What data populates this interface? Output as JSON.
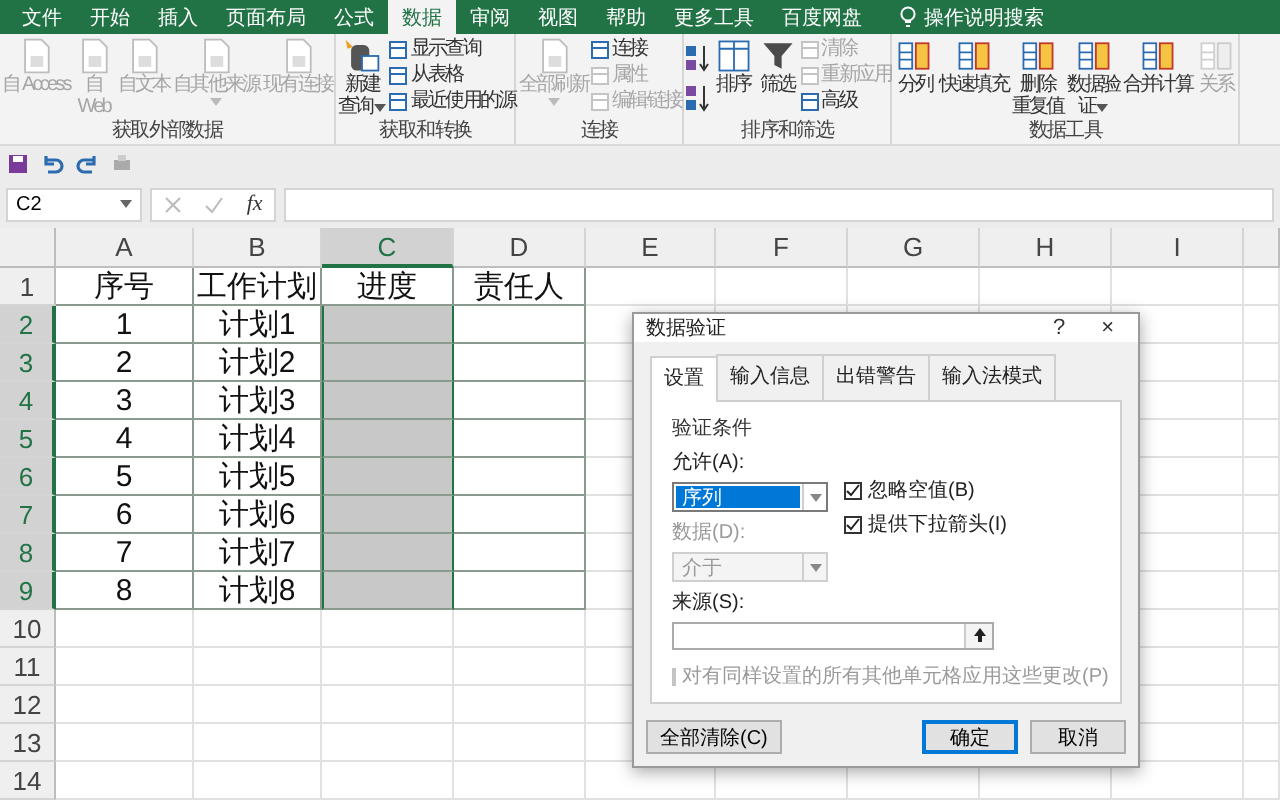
{
  "ribbon_tabs": [
    {
      "label": "文件",
      "selected": false
    },
    {
      "label": "开始",
      "selected": false
    },
    {
      "label": "插入",
      "selected": false
    },
    {
      "label": "页面布局",
      "selected": false
    },
    {
      "label": "公式",
      "selected": false
    },
    {
      "label": "数据",
      "selected": true
    },
    {
      "label": "审阅",
      "selected": false
    },
    {
      "label": "视图",
      "selected": false
    },
    {
      "label": "帮助",
      "selected": false
    },
    {
      "label": "更多工具",
      "selected": false
    },
    {
      "label": "百度网盘",
      "selected": false
    }
  ],
  "search": {
    "label": "操作说明搜索"
  },
  "ribbon_groups": [
    {
      "label": "获取外部数据",
      "items": [
        {
          "kind": "large",
          "lines": [
            "自 Access"
          ],
          "disabled": true,
          "dropdown": false
        },
        {
          "kind": "large",
          "lines": [
            "自",
            "Web"
          ],
          "disabled": true,
          "dropdown": false
        },
        {
          "kind": "large",
          "lines": [
            "自文本"
          ],
          "disabled": true,
          "dropdown": false
        },
        {
          "kind": "large",
          "lines": [
            "自其他来源"
          ],
          "disabled": true,
          "dropdown": true
        },
        {
          "kind": "large",
          "lines": [
            "现有连接"
          ],
          "disabled": true,
          "dropdown": false
        }
      ]
    },
    {
      "label": "获取和转换",
      "items": [
        {
          "kind": "large",
          "lines": [
            "新建",
            "查询"
          ],
          "disabled": false,
          "dropdown": true
        },
        {
          "kind": "stack",
          "items": [
            {
              "label": "显示查询",
              "disabled": false
            },
            {
              "label": "从表格",
              "disabled": false
            },
            {
              "label": "最近使用的源",
              "disabled": false
            }
          ]
        }
      ]
    },
    {
      "label": "连接",
      "items": [
        {
          "kind": "large",
          "lines": [
            "全部刷新"
          ],
          "disabled": true,
          "dropdown": true
        },
        {
          "kind": "stack",
          "items": [
            {
              "label": "连接",
              "disabled": false
            },
            {
              "label": "属性",
              "disabled": true
            },
            {
              "label": "编辑链接",
              "disabled": true
            }
          ]
        }
      ]
    },
    {
      "label": "排序和筛选",
      "items": [
        {
          "kind": "sort"
        },
        {
          "kind": "large",
          "lines": [
            "排序"
          ],
          "disabled": false,
          "dropdown": false
        },
        {
          "kind": "large",
          "lines": [
            "筛选"
          ],
          "disabled": false,
          "dropdown": false
        },
        {
          "kind": "stack",
          "items": [
            {
              "label": "清除",
              "disabled": true
            },
            {
              "label": "重新应用",
              "disabled": true
            },
            {
              "label": "高级",
              "disabled": false
            }
          ]
        }
      ]
    },
    {
      "label": "数据工具",
      "items": [
        {
          "kind": "large",
          "lines": [
            "分列"
          ],
          "disabled": false,
          "dropdown": false
        },
        {
          "kind": "large",
          "lines": [
            "快速填充"
          ],
          "disabled": false,
          "dropdown": false
        },
        {
          "kind": "large",
          "lines": [
            "删除",
            "重复值"
          ],
          "disabled": false,
          "dropdown": false
        },
        {
          "kind": "large",
          "lines": [
            "数据验",
            "证"
          ],
          "disabled": false,
          "dropdown": true
        },
        {
          "kind": "large",
          "lines": [
            "合并计算"
          ],
          "disabled": false,
          "dropdown": false
        },
        {
          "kind": "large",
          "lines": [
            "关系"
          ],
          "disabled": true,
          "dropdown": false
        }
      ]
    }
  ],
  "name_box": {
    "value": "C2"
  },
  "formula_bar": {
    "function_label": "fx"
  },
  "sheet": {
    "columns": [
      {
        "label": "A",
        "selected": false
      },
      {
        "label": "B",
        "selected": false
      },
      {
        "label": "C",
        "selected": true
      },
      {
        "label": "D",
        "selected": false
      },
      {
        "label": "E",
        "selected": false
      },
      {
        "label": "F",
        "selected": false
      },
      {
        "label": "G",
        "selected": false
      },
      {
        "label": "H",
        "selected": false
      },
      {
        "label": "I",
        "selected": false
      }
    ],
    "rows": [
      {
        "number": "1",
        "selected": false,
        "cells": [
          {
            "text": "序号",
            "selected": false
          },
          {
            "text": "工作计划",
            "selected": false
          },
          {
            "text": "进度",
            "selected": false
          },
          {
            "text": "责任人",
            "selected": false
          }
        ]
      },
      {
        "number": "2",
        "selected": true,
        "cells": [
          {
            "text": "1",
            "selected": false
          },
          {
            "text": "计划1",
            "selected": false
          },
          {
            "text": "",
            "selected": true
          },
          {
            "text": "",
            "selected": false
          }
        ]
      },
      {
        "number": "3",
        "selected": true,
        "cells": [
          {
            "text": "2",
            "selected": false
          },
          {
            "text": "计划2",
            "selected": false
          },
          {
            "text": "",
            "selected": true
          },
          {
            "text": "",
            "selected": false
          }
        ]
      },
      {
        "number": "4",
        "selected": true,
        "cells": [
          {
            "text": "3",
            "selected": false
          },
          {
            "text": "计划3",
            "selected": false
          },
          {
            "text": "",
            "selected": true
          },
          {
            "text": "",
            "selected": false
          }
        ]
      },
      {
        "number": "5",
        "selected": true,
        "cells": [
          {
            "text": "4",
            "selected": false
          },
          {
            "text": "计划4",
            "selected": false
          },
          {
            "text": "",
            "selected": true
          },
          {
            "text": "",
            "selected": false
          }
        ]
      },
      {
        "number": "6",
        "selected": true,
        "cells": [
          {
            "text": "5",
            "selected": false
          },
          {
            "text": "计划5",
            "selected": false
          },
          {
            "text": "",
            "selected": true
          },
          {
            "text": "",
            "selected": false
          }
        ]
      },
      {
        "number": "7",
        "selected": true,
        "cells": [
          {
            "text": "6",
            "selected": false
          },
          {
            "text": "计划6",
            "selected": false
          },
          {
            "text": "",
            "selected": true
          },
          {
            "text": "",
            "selected": false
          }
        ]
      },
      {
        "number": "8",
        "selected": true,
        "cells": [
          {
            "text": "7",
            "selected": false
          },
          {
            "text": "计划7",
            "selected": false
          },
          {
            "text": "",
            "selected": true
          },
          {
            "text": "",
            "selected": false
          }
        ]
      },
      {
        "number": "9",
        "selected": true,
        "cells": [
          {
            "text": "8",
            "selected": false
          },
          {
            "text": "计划8",
            "selected": false
          },
          {
            "text": "",
            "selected": true
          },
          {
            "text": "",
            "selected": false
          }
        ]
      },
      {
        "number": "10",
        "selected": false,
        "cells": []
      },
      {
        "number": "11",
        "selected": false,
        "cells": []
      },
      {
        "number": "12",
        "selected": false,
        "cells": []
      },
      {
        "number": "13",
        "selected": false,
        "cells": []
      },
      {
        "number": "14",
        "selected": false,
        "cells": []
      }
    ]
  },
  "dialog": {
    "title": "数据验证",
    "help": "?",
    "close": "×",
    "tabs": [
      {
        "label": "设置",
        "selected": true
      },
      {
        "label": "输入信息",
        "selected": false
      },
      {
        "label": "出错警告",
        "selected": false
      },
      {
        "label": "输入法模式",
        "selected": false
      }
    ],
    "section": "验证条件",
    "allow": {
      "label": "允许(A):",
      "value": "序列",
      "disabled": false
    },
    "options": [
      {
        "label": "忽略空值(B)",
        "checked": true,
        "disabled": false
      },
      {
        "label": "提供下拉箭头(I)",
        "checked": true,
        "disabled": false
      }
    ],
    "data": {
      "label": "数据(D):",
      "value": "介于",
      "disabled": true
    },
    "source": {
      "label": "来源(S):"
    },
    "apply_all": {
      "label": "对有同样设置的所有其他单元格应用这些更改(P)",
      "checked": false,
      "disabled": true
    },
    "buttons": [
      {
        "label": "全部清除(C)",
        "primary": false
      },
      {
        "label": "确定",
        "primary": true
      },
      {
        "label": "取消",
        "primary": false
      }
    ]
  }
}
